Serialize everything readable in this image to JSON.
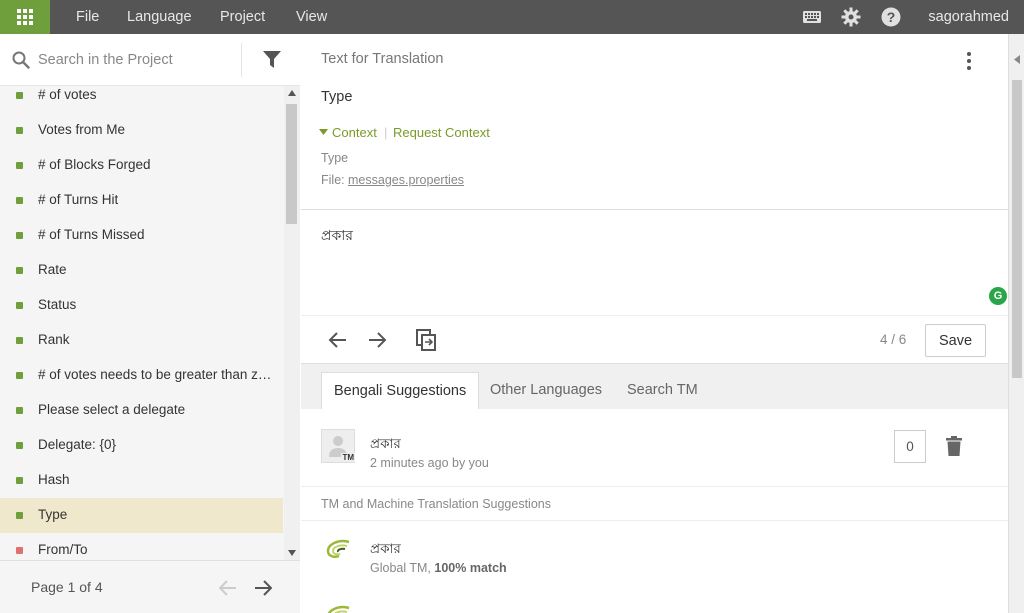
{
  "topbar": {
    "menu": [
      "File",
      "Language",
      "Project",
      "View"
    ],
    "username": "sagorahmed"
  },
  "search": {
    "placeholder": "Search in the Project"
  },
  "strings": [
    {
      "label": "# of votes",
      "status": "translated"
    },
    {
      "label": "Votes from Me",
      "status": "translated"
    },
    {
      "label": "# of Blocks Forged",
      "status": "translated"
    },
    {
      "label": "# of Turns Hit",
      "status": "translated"
    },
    {
      "label": "# of Turns Missed",
      "status": "translated"
    },
    {
      "label": "Rate",
      "status": "translated"
    },
    {
      "label": "Status",
      "status": "translated"
    },
    {
      "label": "Rank",
      "status": "translated"
    },
    {
      "label": "# of votes needs to be greater than z…",
      "status": "translated"
    },
    {
      "label": "Please select a delegate",
      "status": "translated"
    },
    {
      "label": "Delegate: {0}",
      "status": "translated"
    },
    {
      "label": "Hash",
      "status": "translated"
    },
    {
      "label": "Type",
      "status": "translated",
      "selected": true
    },
    {
      "label": "From/To",
      "status": "untranslated"
    }
  ],
  "status_colors": {
    "translated": "#6f9e3c",
    "untranslated": "#e07070"
  },
  "pager": {
    "label": "Page 1 of 4"
  },
  "source": {
    "header": "Text for Translation",
    "text": "Type",
    "context_toggle": "Context",
    "request_context": "Request Context",
    "context_type": "Type",
    "file_label": "File:",
    "file_name": "messages.properties"
  },
  "editor": {
    "translation": "প্রকার"
  },
  "toolbar": {
    "counter": "4 / 6",
    "save_label": "Save"
  },
  "tabs": [
    "Bengali Suggestions",
    "Other Languages",
    "Search TM"
  ],
  "suggestions": {
    "user": {
      "text": "প্রকার",
      "meta": "2 minutes ago by you",
      "votes": "0",
      "badge": "TM"
    },
    "tm_header": "TM and Machine Translation Suggestions",
    "tm": {
      "text": "প্রকার",
      "source": "Global TM,",
      "match": "100% match"
    }
  }
}
